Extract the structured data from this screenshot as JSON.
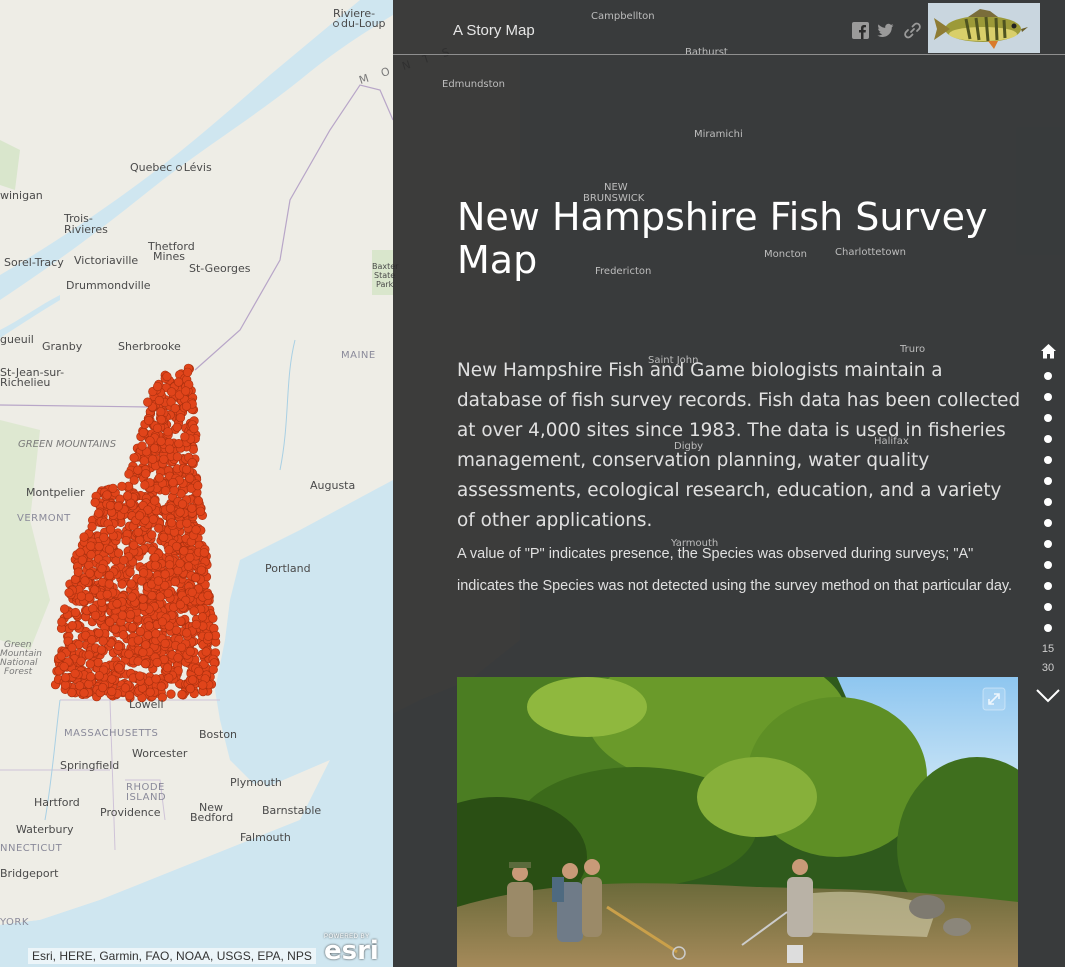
{
  "header": {
    "story_label": "A Story Map",
    "share_icons": [
      "facebook-icon",
      "twitter-icon",
      "link-icon"
    ]
  },
  "story": {
    "title": "New Hampshire Fish Survey Map",
    "description": "New Hampshire Fish and Game biologists maintain a database of fish survey records. Fish data has been collected at over 4,000 sites since 1983. The data is used in fisheries management, conservation planning, water quality assessments, ecological research, education, and a variety of other applications.",
    "note": "A value of \"P\" indicates presence, the Species was observed during surveys; \"A\" indicates the Species was not detected using the survey method on that particular day."
  },
  "navigation": {
    "pages_visible": [
      "15",
      "30"
    ]
  },
  "map": {
    "attribution": "Esri, HERE, Garmin, FAO, NOAA, USGS, EPA, NPS",
    "powered_by": "POWERED BY",
    "esri_logo": "esri",
    "labels": {
      "riviere": "Riviere-",
      "duloup": "du-Loup",
      "quebec": "Quebec",
      "levis": "Lévis",
      "winigan": "winigan",
      "trois": "Trois-",
      "rivieres": "Rivieres",
      "thetford": "Thetford",
      "mines": "Mines",
      "sorel": "Sorel-Tracy",
      "victoriaville": "Victoriaville",
      "stgeorges": "St-Georges",
      "drummondville": "Drummondville",
      "gueuil": "gueuil",
      "granby": "Granby",
      "sherbrooke": "Sherbrooke",
      "stjean": "St-Jean-sur-",
      "richelieu": "Richelieu",
      "maine": "MAINE",
      "greenmountains": "GREEN MOUNTAINS",
      "montpelier": "Montpelier",
      "vermont": "VERMONT",
      "augusta": "Augusta",
      "portland": "Portland",
      "gm1": "Green",
      "gm2": "Mountain",
      "gm3": "National",
      "gm4": "Forest",
      "lowell": "Lowell",
      "massachusetts": "MASSACHUSETTS",
      "boston": "Boston",
      "worcester": "Worcester",
      "springfield": "Springfield",
      "rhode": "RHODE",
      "island": "ISLAND",
      "plymouth": "Plymouth",
      "hartford": "Hartford",
      "providence": "Providence",
      "new": "New",
      "bedford": "Bedford",
      "barnstable": "Barnstable",
      "waterbury": "Waterbury",
      "falmouth": "Falmouth",
      "connecticut": "NNECTICUT",
      "bridgeport": "Bridgeport",
      "york": "YORK",
      "baxter1": "Baxter",
      "baxter2": "State",
      "baxter3": "Park",
      "campbellton": "Campbellton",
      "bathurst": "Bathurst",
      "edmundston": "Edmundston",
      "miramichi": "Miramichi",
      "newbrunswick1": "NEW",
      "newbrunswick2": "BRUNSWICK",
      "moncton": "Moncton",
      "charlottetown": "Charlottetown",
      "fredericton": "Fredericton",
      "saintjohn": "Saint John",
      "truro": "Truro",
      "halifax": "Halifax",
      "digby": "Digby",
      "yarmouth": "Yarmouth",
      "monts": "M O N T S"
    }
  },
  "colors": {
    "panel_bg": "#282828",
    "survey_point": "#e0441a",
    "water": "#cfe6f0",
    "land": "#eeede6"
  }
}
